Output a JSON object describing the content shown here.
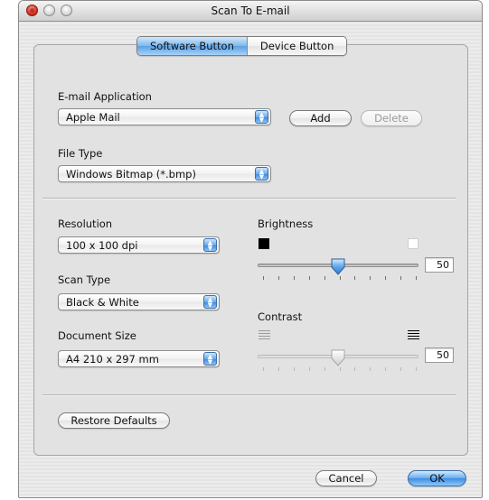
{
  "window": {
    "title": "Scan To E-mail"
  },
  "tabs": {
    "software": "Software Button",
    "device": "Device Button"
  },
  "email_app": {
    "label": "E-mail Application",
    "value": "Apple Mail",
    "add": "Add",
    "delete": "Delete"
  },
  "file_type": {
    "label": "File Type",
    "value": "Windows Bitmap (*.bmp)"
  },
  "resolution": {
    "label": "Resolution",
    "value": "100 x 100 dpi"
  },
  "scan_type": {
    "label": "Scan Type",
    "value": "Black & White"
  },
  "document_size": {
    "label": "Document Size",
    "value": "A4 210 x 297 mm"
  },
  "brightness": {
    "label": "Brightness",
    "value": "50",
    "level": 0.5
  },
  "contrast": {
    "label": "Contrast",
    "value": "50",
    "level": 0.5
  },
  "buttons": {
    "restore": "Restore Defaults",
    "cancel": "Cancel",
    "ok": "OK"
  },
  "colors": {
    "accent": "#5aa0e5",
    "window_bg": "#e8e8e8"
  }
}
